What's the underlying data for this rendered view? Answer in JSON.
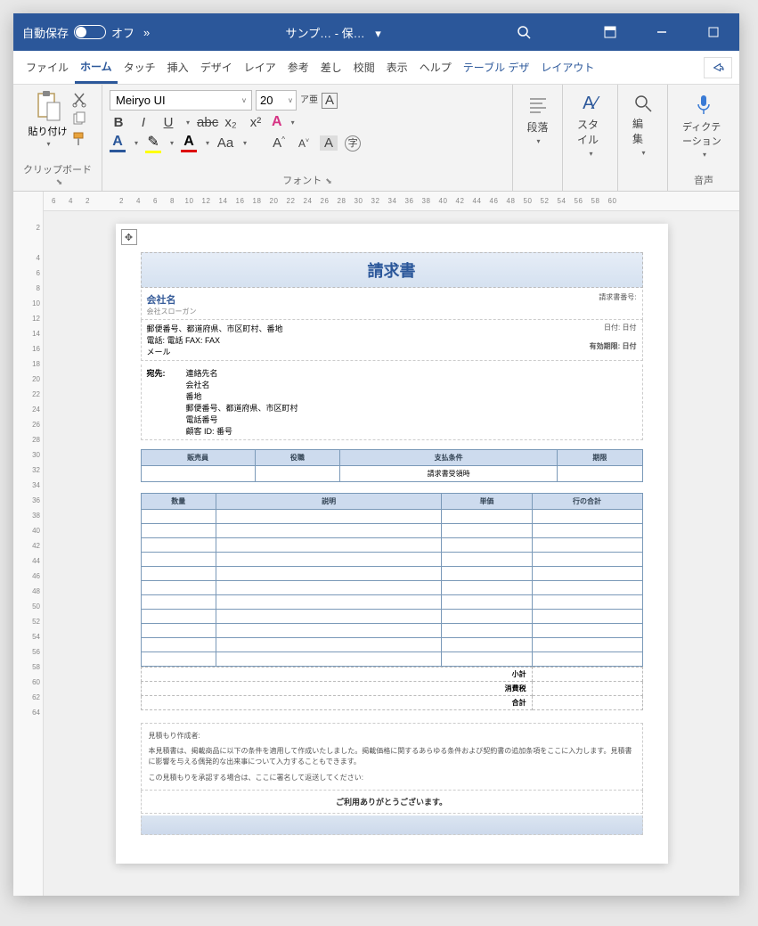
{
  "titlebar": {
    "autosave_label": "自動保存",
    "autosave_state": "オフ",
    "more": "»",
    "doc_title": "サンプ…  - 保…",
    "dropdown": "▾"
  },
  "tabs": {
    "file": "ファイル",
    "home": "ホーム",
    "touch": "タッチ",
    "insert": "挿入",
    "design": "デザイ",
    "layout_tab": "レイア",
    "references": "参考",
    "mailings": "差し",
    "review": "校閲",
    "view": "表示",
    "help": "ヘルプ",
    "table_design": "テーブル デザ",
    "table_layout": "レイアウト"
  },
  "ribbon": {
    "clipboard": {
      "paste": "貼り付け",
      "label": "クリップボード"
    },
    "font": {
      "name": "Meiryo UI",
      "size": "20",
      "label": "フォント",
      "ruby": "ア亜",
      "box_a": "A",
      "bold": "B",
      "italic": "I",
      "underline": "U",
      "strike": "abc",
      "sub": "x₂",
      "sup": "x²",
      "a_big": "A",
      "a_outline": "A",
      "a_fill": "A",
      "aa": "Aa",
      "size_up": "A^",
      "size_down": "A˅",
      "a_highlight": "A",
      "circled": "字"
    },
    "paragraph": {
      "label": "段落"
    },
    "styles": {
      "label": "スタイル"
    },
    "editing": {
      "label": "編集"
    },
    "dictation": {
      "label": "ディクテーション",
      "group": "音声"
    }
  },
  "ruler": {
    "h": [
      "6",
      "4",
      "2",
      "",
      "2",
      "4",
      "6",
      "8",
      "10",
      "12",
      "14",
      "16",
      "18",
      "20",
      "22",
      "24",
      "26",
      "28",
      "30",
      "32",
      "34",
      "36",
      "38",
      "40",
      "42",
      "44",
      "46",
      "48",
      "50",
      "52",
      "54",
      "56",
      "58",
      "60"
    ],
    "v": [
      "2",
      "",
      "4",
      "6",
      "8",
      "10",
      "12",
      "14",
      "16",
      "18",
      "20",
      "22",
      "24",
      "26",
      "28",
      "30",
      "32",
      "34",
      "36",
      "38",
      "40",
      "42",
      "44",
      "46",
      "48",
      "50",
      "52",
      "54",
      "56",
      "58",
      "60",
      "62",
      "64"
    ]
  },
  "doc": {
    "title": "請求書",
    "company": "会社名",
    "slogan": "会社スローガン",
    "addr": "郵便番号、都道府県、市区町村、番地",
    "phone": "電話: 電話 FAX: FAX",
    "mail": "メール",
    "meta_invoice": "請求書番号:",
    "meta_date": "日付: 日付",
    "meta_expiry": "有効期限: 日付",
    "to_label": "宛先:",
    "to_name": "連絡先名",
    "to_company": "会社名",
    "to_address1": "番地",
    "to_address2": "郵便番号、都道府県、市区町村",
    "to_phone": "電話番号",
    "to_customer": "顧客 ID: 番号",
    "sec_headers": {
      "sales": "販売員",
      "role": "役職",
      "terms": "支払条件",
      "due": "期限"
    },
    "sec_terms_value": "請求書受領時",
    "item_headers": {
      "qty": "数量",
      "desc": "説明",
      "unit": "単価",
      "line": "行の合計"
    },
    "totals": {
      "subtotal": "小計",
      "tax": "消費税",
      "total": "合計"
    },
    "notes_author": "見積もり作成者:",
    "notes_body": "本見積書は、掲載商品に以下の条件を適用して作成いたしました。掲載価格に関するあらゆる条件および契約書の追加条項をここに入力します。見積書に影響を与える偶発的な出来事について入力することもできます。",
    "notes_line": "この見積もりを承認する場合は、ここに署名して返送してください:",
    "thanks": "ご利用ありがとうございます。"
  }
}
